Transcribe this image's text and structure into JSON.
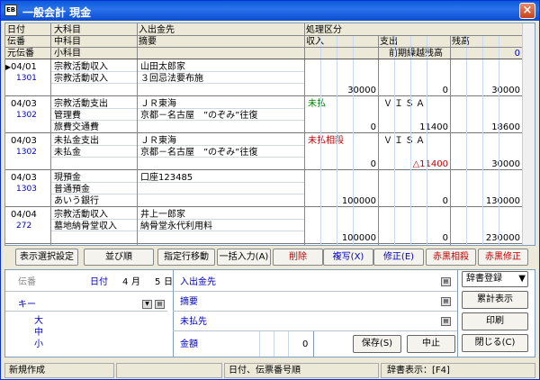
{
  "window": {
    "title": "一般会計 現金",
    "app_icon_text": "EB",
    "close_label": "×"
  },
  "header": {
    "row1": [
      "日付",
      "大科目",
      "入出金先",
      "処理区分"
    ],
    "row2": [
      "伝番",
      "中科目",
      "摘要",
      "収入",
      "支出",
      "残高"
    ],
    "row3": [
      "元伝番",
      "小科目",
      "前期繰越残高",
      "0"
    ]
  },
  "records": [
    {
      "date": "04/01",
      "no": "1301",
      "lines": [
        "宗教活動収入",
        "宗教活動収入",
        ""
      ],
      "party": "山田太郎家",
      "memo": "３回忌法要布施",
      "status": "",
      "pay": "",
      "income": "30000",
      "expense": "0",
      "balance": "30000"
    },
    {
      "date": "04/03",
      "no": "1302",
      "lines": [
        "宗教活動支出",
        "管理費",
        "旅費交通費"
      ],
      "party": "ＪＲ東海",
      "memo": "京都－名古屋　”のぞみ”往復",
      "status": "未払",
      "pay": "ＶＩＳＡ",
      "income": "0",
      "expense": "11400",
      "balance": "18600"
    },
    {
      "date": "04/03",
      "no": "1302",
      "lines": [
        "未払金支出",
        "未払金",
        ""
      ],
      "party": "ＪＲ東海",
      "memo": "京都－名古屋　”のぞみ”往復",
      "status": "未払相殺",
      "pay": "ＶＩＳＡ",
      "income": "0",
      "expense": "△11400",
      "balance": "30000"
    },
    {
      "date": "04/03",
      "no": "1303",
      "lines": [
        "現預金",
        "普通預金",
        "あいう銀行"
      ],
      "party": "口座123485",
      "memo": "",
      "status": "",
      "pay": "",
      "income": "100000",
      "expense": "0",
      "balance": "130000"
    },
    {
      "date": "04/04",
      "no": "272",
      "lines": [
        "宗教活動収入",
        "墓地納骨堂収入",
        ""
      ],
      "party": "井上一郎家",
      "memo": "納骨堂永代利用料",
      "status": "",
      "pay": "",
      "income": "100000",
      "expense": "0",
      "balance": "230000"
    }
  ],
  "toolbar": [
    "表示選択設定",
    "並び順",
    "指定行移動",
    "一括入力(A)",
    "削除",
    "複写(X)",
    "修正(E)",
    "赤黒相殺",
    "赤黒修正"
  ],
  "form": {
    "denban_label": "伝番",
    "date_label": "日付",
    "month": "4",
    "month_unit": "月",
    "day": "5",
    "day_unit": "日",
    "key_label": "キー",
    "levels": [
      "大",
      "中",
      "小"
    ],
    "fields": [
      "入出金先",
      "摘要",
      "未払先"
    ],
    "amount_label": "金額",
    "amount_value": "0",
    "save_label": "保存(S)",
    "cancel_label": "中止"
  },
  "side_buttons": {
    "dict_register": "辞書登録",
    "cumulative": "累計表示",
    "print": "印刷",
    "close": "閉じる(C)"
  },
  "status": {
    "mode": "新規作成",
    "sort": "日付、伝票番号順",
    "dict": "辞書表示：[F4]"
  }
}
